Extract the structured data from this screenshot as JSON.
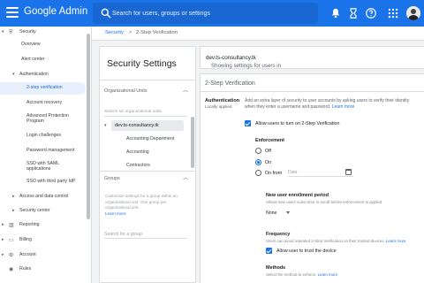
{
  "header": {
    "logo": "Google Admin",
    "search_placeholder": "Search for users, groups or settings"
  },
  "breadcrumb": {
    "root": "Security",
    "sep": ">",
    "current": "2-Step Verification"
  },
  "leftnav": {
    "items": [
      {
        "label": "Security"
      },
      {
        "label": "Overview"
      },
      {
        "label": "Alert center"
      },
      {
        "label": "Authentication"
      },
      {
        "label": "2-step verification"
      },
      {
        "label": "Account recovery"
      },
      {
        "label": "Advanced Protection Program"
      },
      {
        "label": "Login challenges"
      },
      {
        "label": "Password management"
      },
      {
        "label": "SSO with SAML applications"
      },
      {
        "label": "SSO with third party IdP"
      },
      {
        "label": "Access and data control"
      },
      {
        "label": "Security center"
      },
      {
        "label": "Reporting"
      },
      {
        "label": "Billing"
      },
      {
        "label": "Account"
      },
      {
        "label": "Rules"
      }
    ]
  },
  "settings_panel": {
    "title": "Security Settings",
    "org_units_header": "Organizational Units",
    "org_search_placeholder": "Search for organizational units",
    "root_org": "dev.ts-consultancy.tk",
    "child_orgs": [
      "Accounting Department",
      "Accounting",
      "Contractors"
    ],
    "groups_header": "Groups",
    "groups_desc": "Customize settings for a group within an organizational unit. One group per organizational unit.",
    "learn_more": "Learn more",
    "group_search_placeholder": "Search for a group"
  },
  "showing": {
    "prefix": "Showing settings for users in",
    "org": "dev.ts-consultancy.tk"
  },
  "verification": {
    "card_title": "2-Step Verification",
    "auth_label": "Authentication",
    "auth_sub": "Locally applied",
    "auth_desc": "Add an extra layer of security to user accounts by asking users to verify their identity when they enter a username and password.",
    "learn_more": "Learn more",
    "allow_checkbox_label": "Allow users to turn on 2-Step Verification",
    "allow_checked": true,
    "enforcement_title": "Enforcement",
    "enforcement_options": [
      "Off",
      "On",
      "On from"
    ],
    "enforcement_selected": "On",
    "date_placeholder": "Date",
    "new_user_title": "New user enrollment period",
    "new_user_desc": "Allows new users some time to enroll before enforcement is applied",
    "new_user_value": "None",
    "frequency_title": "Frequency",
    "frequency_desc": "Users can avoid repeated 2-Step Verification on their trusted devices.",
    "frequency_learn_more": "Learn more",
    "trust_device_label": "Allow user to trust the device",
    "trust_checked": true,
    "methods_title": "Methods",
    "methods_desc": "Select the method to enforce.",
    "methods_learn_more": "Learn more"
  }
}
